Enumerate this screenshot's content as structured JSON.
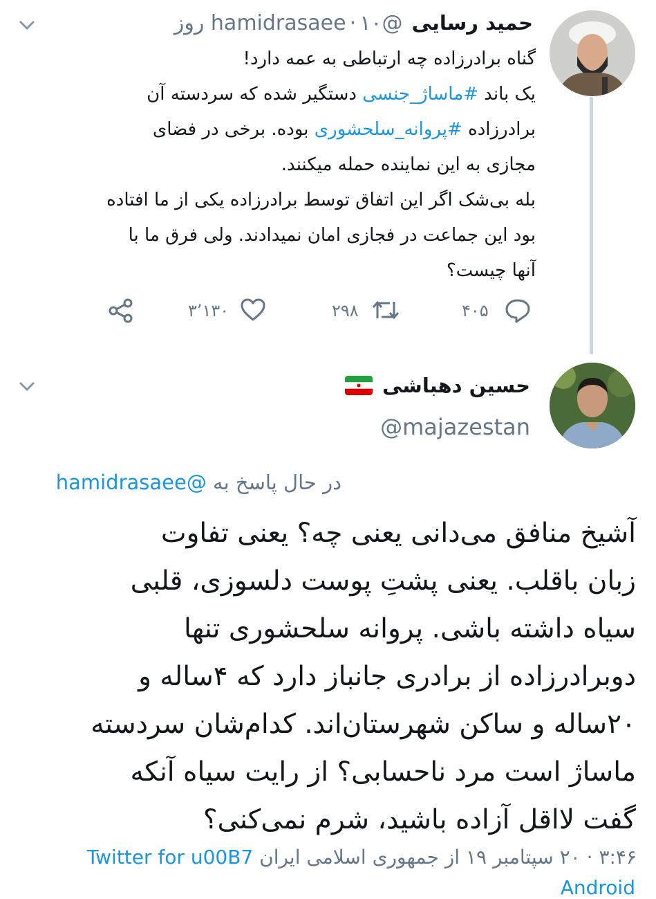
{
  "tweet1": {
    "author_name": "حمید رسایی",
    "handle": "@hamidrasaee",
    "separator": "·",
    "time": "۱۰ روز",
    "lines": [
      {
        "parts": [
          {
            "t": "گناه برادرزاده چه ارتباطی به عمه دارد!",
            "h": false
          }
        ]
      },
      {
        "parts": [
          {
            "t": "یک باند ",
            "h": false
          },
          {
            "t": "#ماساژ_جنسی",
            "h": true
          },
          {
            "t": " دستگیر شده که سردسته آن",
            "h": false
          }
        ]
      },
      {
        "parts": [
          {
            "t": "برادرزاده ",
            "h": false
          },
          {
            "t": "#پروانه_سلحشوری",
            "h": true
          },
          {
            "t": " بوده. برخی در فضای",
            "h": false
          }
        ]
      },
      {
        "parts": [
          {
            "t": "مجازی به این نماینده حمله میکنند.",
            "h": false
          }
        ]
      },
      {
        "parts": [
          {
            "t": "بله بی‌شک اگر این اتفاق توسط برادرزاده یکی از ما افتاده",
            "h": false
          }
        ]
      },
      {
        "parts": [
          {
            "t": "بود این جماعت در فجازی امان نمیدادند. ولی فرق ما با",
            "h": false
          }
        ]
      },
      {
        "parts": [
          {
            "t": "آنها چیست؟",
            "h": false
          }
        ]
      }
    ],
    "reply_count": "۴۰۵",
    "retweet_count": "۲۹۸",
    "like_count": "۳٬۱۳۰"
  },
  "tweet2": {
    "author_name": "حسین دهباشی",
    "handle": "@majazestan",
    "reply_prefix": "در حال پاسخ به",
    "reply_mention": "@hamidrasaee",
    "lines": [
      "آشیخ منافق می‌دانی یعنی چه؟ یعنی تفاوت",
      "زبان باقلب. یعنی پشتِ پوست دلسوزی، قلبی",
      "سیاه داشته باشی. پروانه سلحشوری تنها",
      "دوبرادرزاده از برادری جانباز دارد که ۴ساله و",
      "۲۰ساله و ساکن شهرستان‌اند. کدام‌شان سردسته",
      "ماساژ است مرد ناحسابی؟ از رایت سیاه آنکه",
      "گفت لااقل آزاده باشید، شرم نمی‌کنی؟"
    ],
    "footer_time": "۳:۴۶ · ۲۰",
    "footer_date": "سپتامبر ۱۹ از جمهوری اسلامی ایران",
    "footer_source": "Twitter for u00B7",
    "footer_source2": "Android"
  },
  "colors": {
    "link": "#1b95e0",
    "secondary": "#657786",
    "text": "#14171a",
    "thread": "#ccd6dd"
  },
  "icons": [
    "chevron-down-icon",
    "reply-icon",
    "retweet-icon",
    "like-icon",
    "share-icon",
    "iran-flag-icon"
  ]
}
